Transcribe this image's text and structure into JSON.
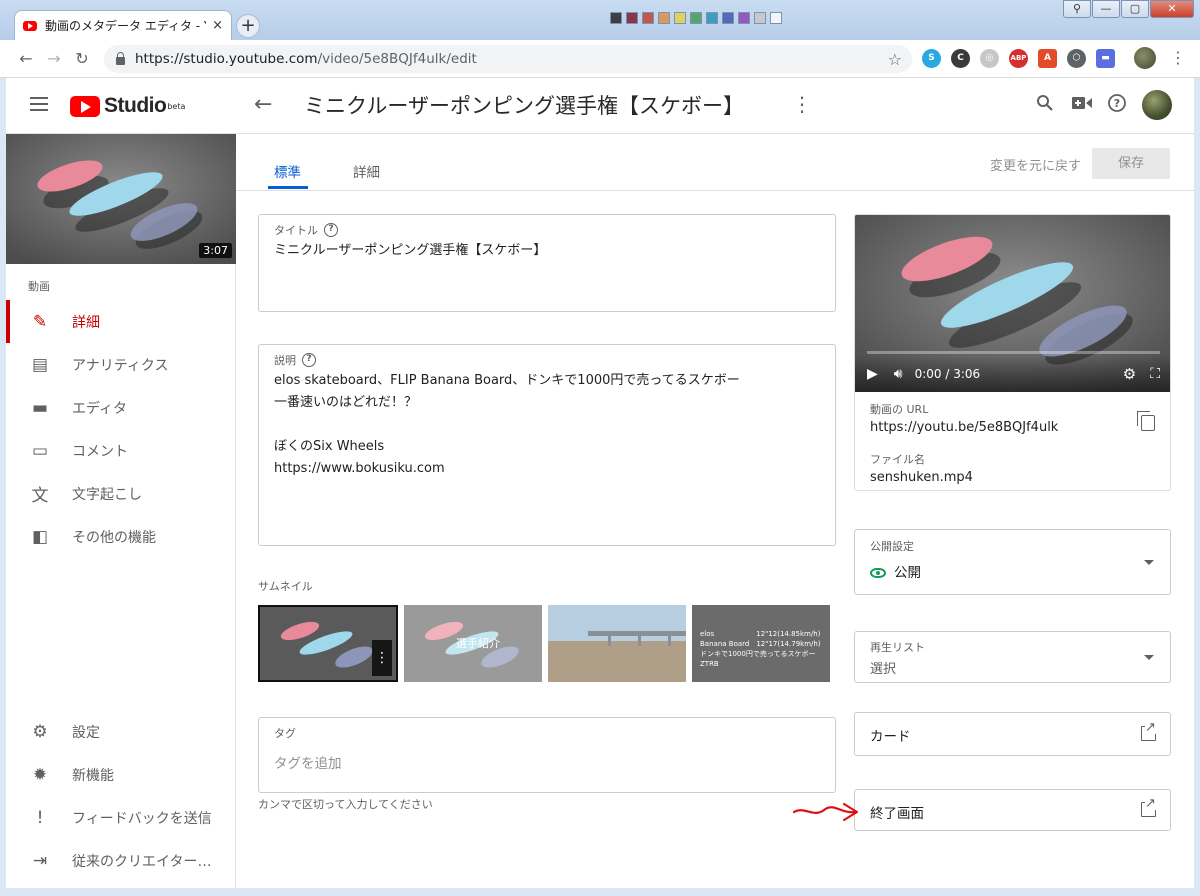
{
  "browser": {
    "tab_title": "動画のメタデータ エディタ - Yo",
    "tab_close": "×",
    "new_tab": "+",
    "url_prefix": "https://studio.youtube.com",
    "url_path": "/video/5e8BQJf4ulk/edit",
    "window_controls": [
      "⚲",
      "—",
      "▢",
      "✕"
    ],
    "swatch_colors": [
      "#1a1a1a",
      "#7a1020",
      "#c0392b",
      "#e08a3c",
      "#e8d33c",
      "#3c9a4a",
      "#1f8fb5",
      "#3a4fb0",
      "#8a3ab0",
      "#c8c8c8",
      "#ffffff"
    ]
  },
  "header": {
    "logo_text": "Studio",
    "logo_beta": "beta",
    "title": "ミニクルーザーポンピング選手権【スケボー】"
  },
  "sidebar": {
    "duration": "3:07",
    "section_label": "動画",
    "items": [
      {
        "label": "詳細",
        "icon": "pencil-icon"
      },
      {
        "label": "アナリティクス",
        "icon": "analytics-icon"
      },
      {
        "label": "エディタ",
        "icon": "clapper-icon"
      },
      {
        "label": "コメント",
        "icon": "comment-icon"
      },
      {
        "label": "文字起こし",
        "icon": "translate-icon"
      },
      {
        "label": "その他の機能",
        "icon": "more-features-icon"
      }
    ],
    "bottom_items": [
      {
        "label": "設定",
        "icon": "gear-icon"
      },
      {
        "label": "新機能",
        "icon": "new-badge-icon"
      },
      {
        "label": "フィードバックを送信",
        "icon": "feedback-icon"
      },
      {
        "label": "従来のクリエイター…",
        "icon": "exit-icon"
      }
    ]
  },
  "tabs": [
    {
      "label": "標準"
    },
    {
      "label": "詳細"
    }
  ],
  "actions": {
    "undo": "変更を元に戻す",
    "save": "保存"
  },
  "form": {
    "title_label": "タイトル",
    "title_value": "ミニクルーザーポンピング選手権【スケボー】",
    "description_label": "説明",
    "description_value": "elos skateboard、FLIP Banana Board、ドンキで1000円で売ってるスケボー\n一番速いのはどれだ！？\n\nぼくのSix Wheels\nhttps://www.bokusiku.com",
    "thumbnails_label": "サムネイル",
    "thumb2_caption": "選手紹介",
    "thumb4_lines": [
      "elos　　　　　　12\"12(14.85km/h)",
      "Banana Board　12\"17(14.79km/h)",
      "ドンキで1000円で売ってるスケボー　ZTRB"
    ],
    "tags_label": "タグ",
    "tags_placeholder": "タグを追加",
    "tags_helper": "カンマで区切って入力してください"
  },
  "player": {
    "time": "0:00 / 3:06",
    "url_label": "動画の URL",
    "url_value": "https://youtu.be/5e8BQJf4ulk",
    "file_label": "ファイル名",
    "file_value": "senshuken.mp4"
  },
  "visibility": {
    "label": "公開設定",
    "value": "公開"
  },
  "playlist": {
    "label": "再生リスト",
    "value": "選択"
  },
  "cards": {
    "label": "カード"
  },
  "end_screen": {
    "label": "終了画面"
  }
}
